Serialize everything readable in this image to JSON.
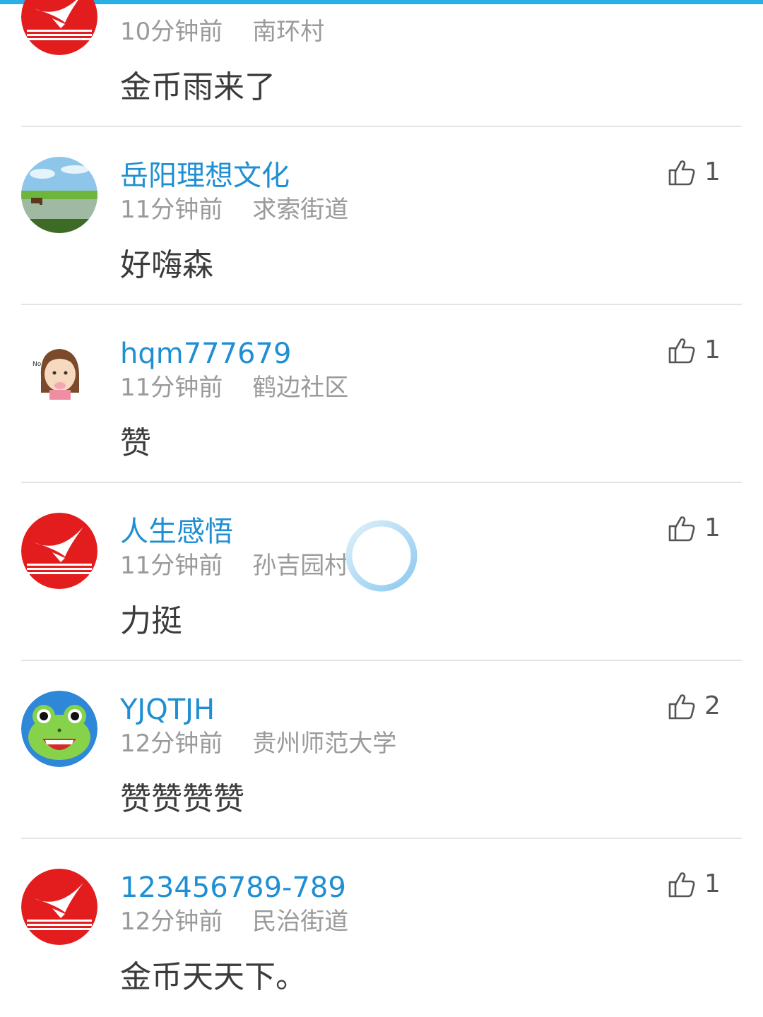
{
  "comments": [
    {
      "name": "",
      "time": "10分钟前",
      "location": "南环村",
      "text": "金币雨来了",
      "likes": "",
      "avatar": "brand-logo-icon"
    },
    {
      "name": "岳阳理想文化",
      "time": "11分钟前",
      "location": "求索街道",
      "text": "好嗨森",
      "likes": "1",
      "avatar": "landscape-photo-icon"
    },
    {
      "name": "hqm777679",
      "time": "11分钟前",
      "location": "鹤边社区",
      "text": "赞",
      "likes": "1",
      "avatar": "cartoon-girl-icon"
    },
    {
      "name": "人生感悟",
      "time": "11分钟前",
      "location": "孙吉园村",
      "text": "力挺",
      "likes": "1",
      "avatar": "brand-logo-icon"
    },
    {
      "name": "YJQTJH",
      "time": "12分钟前",
      "location": "贵州师范大学",
      "text": "赞赞赞赞",
      "likes": "2",
      "avatar": "frog-face-icon"
    },
    {
      "name": "123456789-789",
      "time": "12分钟前",
      "location": "民治街道",
      "text": "金币天天下。",
      "likes": "1",
      "avatar": "brand-logo-icon"
    }
  ],
  "colors": {
    "accent": "#29aee6",
    "username": "#1f8fd3",
    "meta": "#9a9a9a",
    "body_text": "#3b3b3b",
    "brand_red": "#e31d1d"
  }
}
